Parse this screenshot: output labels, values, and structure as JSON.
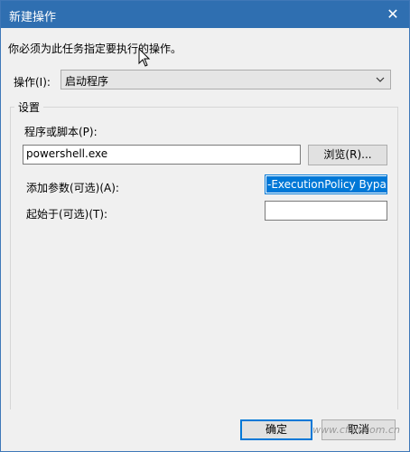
{
  "window": {
    "title": "新建操作",
    "close_label": "✕"
  },
  "instruction": "你必须为此任务指定要执行的操作。",
  "action": {
    "label": "操作(I):",
    "value": "启动程序"
  },
  "settings": {
    "legend": "设置",
    "program": {
      "label": "程序或脚本(P):",
      "value": "powershell.exe",
      "browse_label": "浏览(R)..."
    },
    "arguments": {
      "label": "添加参数(可选)(A):",
      "value": "-ExecutionPolicy Bypas"
    },
    "start_in": {
      "label": "起始于(可选)(T):",
      "value": ""
    }
  },
  "buttons": {
    "ok": "确定",
    "cancel": "取消"
  },
  "watermark": "www.cfan.com.cn",
  "colors": {
    "titlebar": "#2f6fb1",
    "accent": "#0078d7",
    "dialog_bg": "#f0f0f0"
  }
}
